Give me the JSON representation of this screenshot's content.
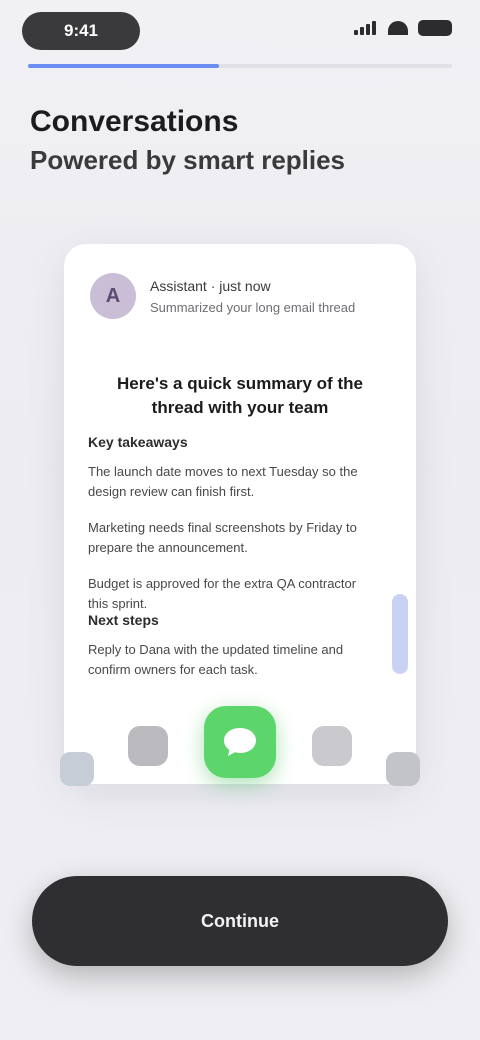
{
  "status_bar": {
    "time": "9:41"
  },
  "onboarding": {
    "progress": 0.45
  },
  "heading": {
    "title": "Conversations",
    "subtitle": "Powered by smart replies"
  },
  "preview": {
    "avatar_initial": "A",
    "sender": "Assistant · just now",
    "sender_sub": "Summarized your long email thread",
    "title": "Here's a quick summary of the thread with your team",
    "sections": [
      {
        "heading": "Key takeaways",
        "paragraphs": [
          "The launch date moves to next Tuesday so the design review can finish first.",
          "Marketing needs final screenshots by Friday to prepare the announcement.",
          "Budget is approved for the extra QA contractor this sprint."
        ]
      },
      {
        "heading": "Next steps",
        "paragraphs": [
          "Reply to Dana with the updated timeline and confirm owners for each task."
        ]
      }
    ]
  },
  "dock": {
    "main_icon": "chat-bubble-icon"
  },
  "cta": {
    "label": "Continue"
  }
}
